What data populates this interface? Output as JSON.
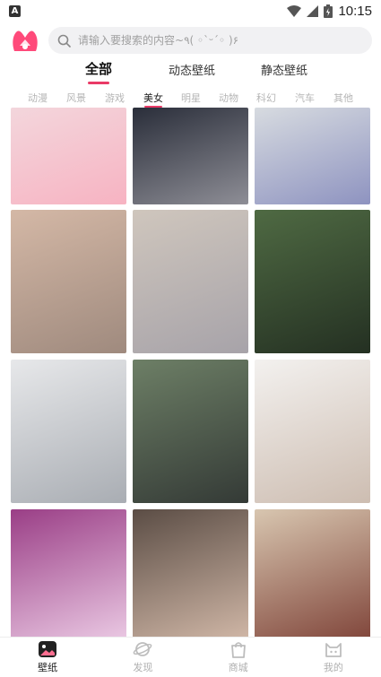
{
  "status_bar": {
    "time": "10:15",
    "notification_glyph": "A"
  },
  "search": {
    "placeholder": "请输入要搜索的内容~٩( ◦`ᵕ´◦ )۶"
  },
  "main_tabs": [
    {
      "label": "全部",
      "active": true
    },
    {
      "label": "动态壁纸",
      "active": false
    },
    {
      "label": "静态壁纸",
      "active": false
    }
  ],
  "categories": [
    {
      "label": "动漫",
      "active": false
    },
    {
      "label": "风景",
      "active": false
    },
    {
      "label": "游戏",
      "active": false
    },
    {
      "label": "美女",
      "active": true
    },
    {
      "label": "明星",
      "active": false
    },
    {
      "label": "动物",
      "active": false
    },
    {
      "label": "科幻",
      "active": false
    },
    {
      "label": "汽车",
      "active": false
    },
    {
      "label": "其他",
      "active": false
    }
  ],
  "wallpapers": [
    {
      "colors": [
        "#f3d6dc",
        "#f7b3c2"
      ]
    },
    {
      "colors": [
        "#2a2e3a",
        "#8e8e96"
      ]
    },
    {
      "colors": [
        "#d7dbe0",
        "#8e93c0"
      ]
    },
    {
      "colors": [
        "#d4b8a6",
        "#9f8a7e"
      ]
    },
    {
      "colors": [
        "#cfc6bd",
        "#a7a3a9"
      ]
    },
    {
      "colors": [
        "#4f6a43",
        "#243022"
      ]
    },
    {
      "colors": [
        "#e7e8ea",
        "#a9adb3"
      ]
    },
    {
      "colors": [
        "#6d7f66",
        "#343a36"
      ]
    },
    {
      "colors": [
        "#f3f1ef",
        "#cdbdb1"
      ]
    },
    {
      "colors": [
        "#9a3e86",
        "#f0d3ea"
      ]
    },
    {
      "colors": [
        "#5b4d45",
        "#d9bfae"
      ]
    },
    {
      "colors": [
        "#d8c6b0",
        "#7a3c32"
      ]
    }
  ],
  "bottom_nav": [
    {
      "label": "壁纸",
      "icon": "image-icon",
      "active": true
    },
    {
      "label": "发现",
      "icon": "planet-icon",
      "active": false
    },
    {
      "label": "商城",
      "icon": "shopping-bag-icon",
      "active": false
    },
    {
      "label": "我的",
      "icon": "cat-face-icon",
      "active": false
    }
  ],
  "theme": {
    "accent": "#e93a66",
    "logo_color": "#ff4a7a"
  }
}
